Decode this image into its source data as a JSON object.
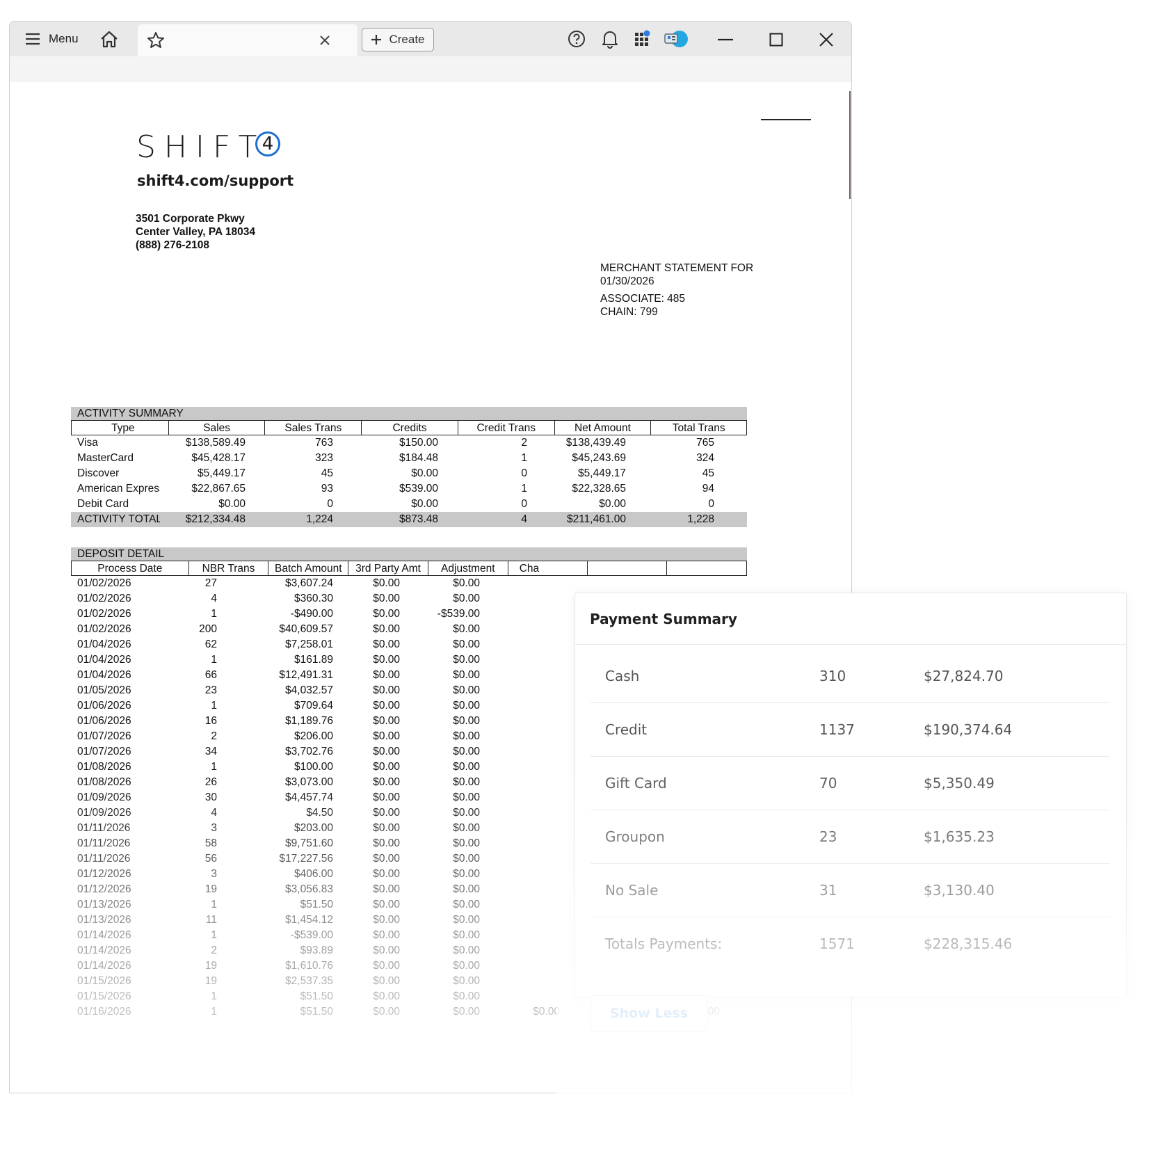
{
  "toolbar": {
    "menu_label": "Menu",
    "create_label": "Create",
    "icons": [
      "menu-icon",
      "home-icon",
      "star-icon",
      "close-tab-icon",
      "plus-icon",
      "help-icon",
      "bell-icon",
      "apps-icon",
      "profile-icon",
      "minimize-icon",
      "maximize-icon",
      "close-icon"
    ]
  },
  "document": {
    "logo_text": "SHIFT",
    "logo_badge": "4",
    "logo_url": "shift4.com/support",
    "address": [
      "3501 Corporate Pkwy",
      "Center Valley, PA 18034",
      "(888) 276-2108"
    ],
    "merchant": {
      "title": "MERCHANT STATEMENT FOR",
      "date": "01/30/2026",
      "associate": "ASSOCIATE: 485",
      "chain": "CHAIN: 799"
    },
    "activity": {
      "title": "ACTIVITY SUMMARY",
      "headers": [
        "Type",
        "Sales",
        "Sales Trans",
        "Credits",
        "Credit Trans",
        "Net Amount",
        "Total Trans"
      ],
      "rows": [
        [
          "Visa",
          "$138,589.49",
          "763",
          "$150.00",
          "2",
          "$138,439.49",
          "765"
        ],
        [
          "MasterCard",
          "$45,428.17",
          "323",
          "$184.48",
          "1",
          "$45,243.69",
          "324"
        ],
        [
          "Discover",
          "$5,449.17",
          "45",
          "$0.00",
          "0",
          "$5,449.17",
          "45"
        ],
        [
          "American Express",
          "$22,867.65",
          "93",
          "$539.00",
          "1",
          "$22,328.65",
          "94"
        ],
        [
          "Debit Card",
          "$0.00",
          "0",
          "$0.00",
          "0",
          "$0.00",
          "0"
        ]
      ],
      "total": [
        "ACTIVITY TOTAL",
        "$212,334.48",
        "1,224",
        "$873.48",
        "4",
        "$211,461.00",
        "1,228"
      ]
    },
    "deposit": {
      "title": "DEPOSIT DETAIL",
      "headers": [
        "Process Date",
        "NBR Trans",
        "Batch Amount",
        "3rd Party Amt",
        "Adjustment",
        "Cha"
      ],
      "rows": [
        [
          "01/02/2026",
          "27",
          "$3,607.24",
          "$0.00",
          "$0.00"
        ],
        [
          "01/02/2026",
          "4",
          "$360.30",
          "$0.00",
          "$0.00"
        ],
        [
          "01/02/2026",
          "1",
          "-$490.00",
          "$0.00",
          "-$539.00"
        ],
        [
          "01/02/2026",
          "200",
          "$40,609.57",
          "$0.00",
          "$0.00"
        ],
        [
          "01/04/2026",
          "62",
          "$7,258.01",
          "$0.00",
          "$0.00"
        ],
        [
          "01/04/2026",
          "1",
          "$161.89",
          "$0.00",
          "$0.00"
        ],
        [
          "01/04/2026",
          "66",
          "$12,491.31",
          "$0.00",
          "$0.00"
        ],
        [
          "01/05/2026",
          "23",
          "$4,032.57",
          "$0.00",
          "$0.00"
        ],
        [
          "01/06/2026",
          "1",
          "$709.64",
          "$0.00",
          "$0.00"
        ],
        [
          "01/06/2026",
          "16",
          "$1,189.76",
          "$0.00",
          "$0.00"
        ],
        [
          "01/07/2026",
          "2",
          "$206.00",
          "$0.00",
          "$0.00"
        ],
        [
          "01/07/2026",
          "34",
          "$3,702.76",
          "$0.00",
          "$0.00"
        ],
        [
          "01/08/2026",
          "1",
          "$100.00",
          "$0.00",
          "$0.00"
        ],
        [
          "01/08/2026",
          "26",
          "$3,073.00",
          "$0.00",
          "$0.00"
        ],
        [
          "01/09/2026",
          "30",
          "$4,457.74",
          "$0.00",
          "$0.00"
        ],
        [
          "01/09/2026",
          "4",
          "$4.50",
          "$0.00",
          "$0.00"
        ],
        [
          "01/11/2026",
          "3",
          "$203.00",
          "$0.00",
          "$0.00"
        ],
        [
          "01/11/2026",
          "58",
          "$9,751.60",
          "$0.00",
          "$0.00"
        ],
        [
          "01/11/2026",
          "56",
          "$17,227.56",
          "$0.00",
          "$0.00"
        ],
        [
          "01/12/2026",
          "3",
          "$406.00",
          "$0.00",
          "$0.00"
        ],
        [
          "01/12/2026",
          "19",
          "$3,056.83",
          "$0.00",
          "$0.00"
        ],
        [
          "01/13/2026",
          "1",
          "$51.50",
          "$0.00",
          "$0.00"
        ],
        [
          "01/13/2026",
          "11",
          "$1,454.12",
          "$0.00",
          "$0.00"
        ],
        [
          "01/14/2026",
          "1",
          "-$539.00",
          "$0.00",
          "$0.00"
        ],
        [
          "01/14/2026",
          "2",
          "$93.89",
          "$0.00",
          "$0.00"
        ],
        [
          "01/14/2026",
          "19",
          "$1,610.76",
          "$0.00",
          "$0.00"
        ],
        [
          "01/15/2026",
          "19",
          "$2,537.35",
          "$0.00",
          "$0.00"
        ],
        [
          "01/15/2026",
          "1",
          "$51.50",
          "$0.00",
          "$0.00"
        ],
        [
          "01/16/2026",
          "1",
          "$51.50",
          "$0.00",
          "$0.00",
          "$0.00",
          "$1.50",
          "$50.00"
        ]
      ]
    }
  },
  "payment_summary": {
    "title": "Payment Summary",
    "rows": [
      [
        "Cash",
        "310",
        "$27,824.70"
      ],
      [
        "Credit",
        "1137",
        "$190,374.64"
      ],
      [
        "Gift Card",
        "70",
        "$5,350.49"
      ],
      [
        "Groupon",
        "23",
        "$1,635.23"
      ],
      [
        "No Sale",
        "31",
        "$3,130.40"
      ],
      [
        "Totals Payments:",
        "1571",
        "$228,315.46"
      ]
    ],
    "show_less_label": "Show Less"
  }
}
